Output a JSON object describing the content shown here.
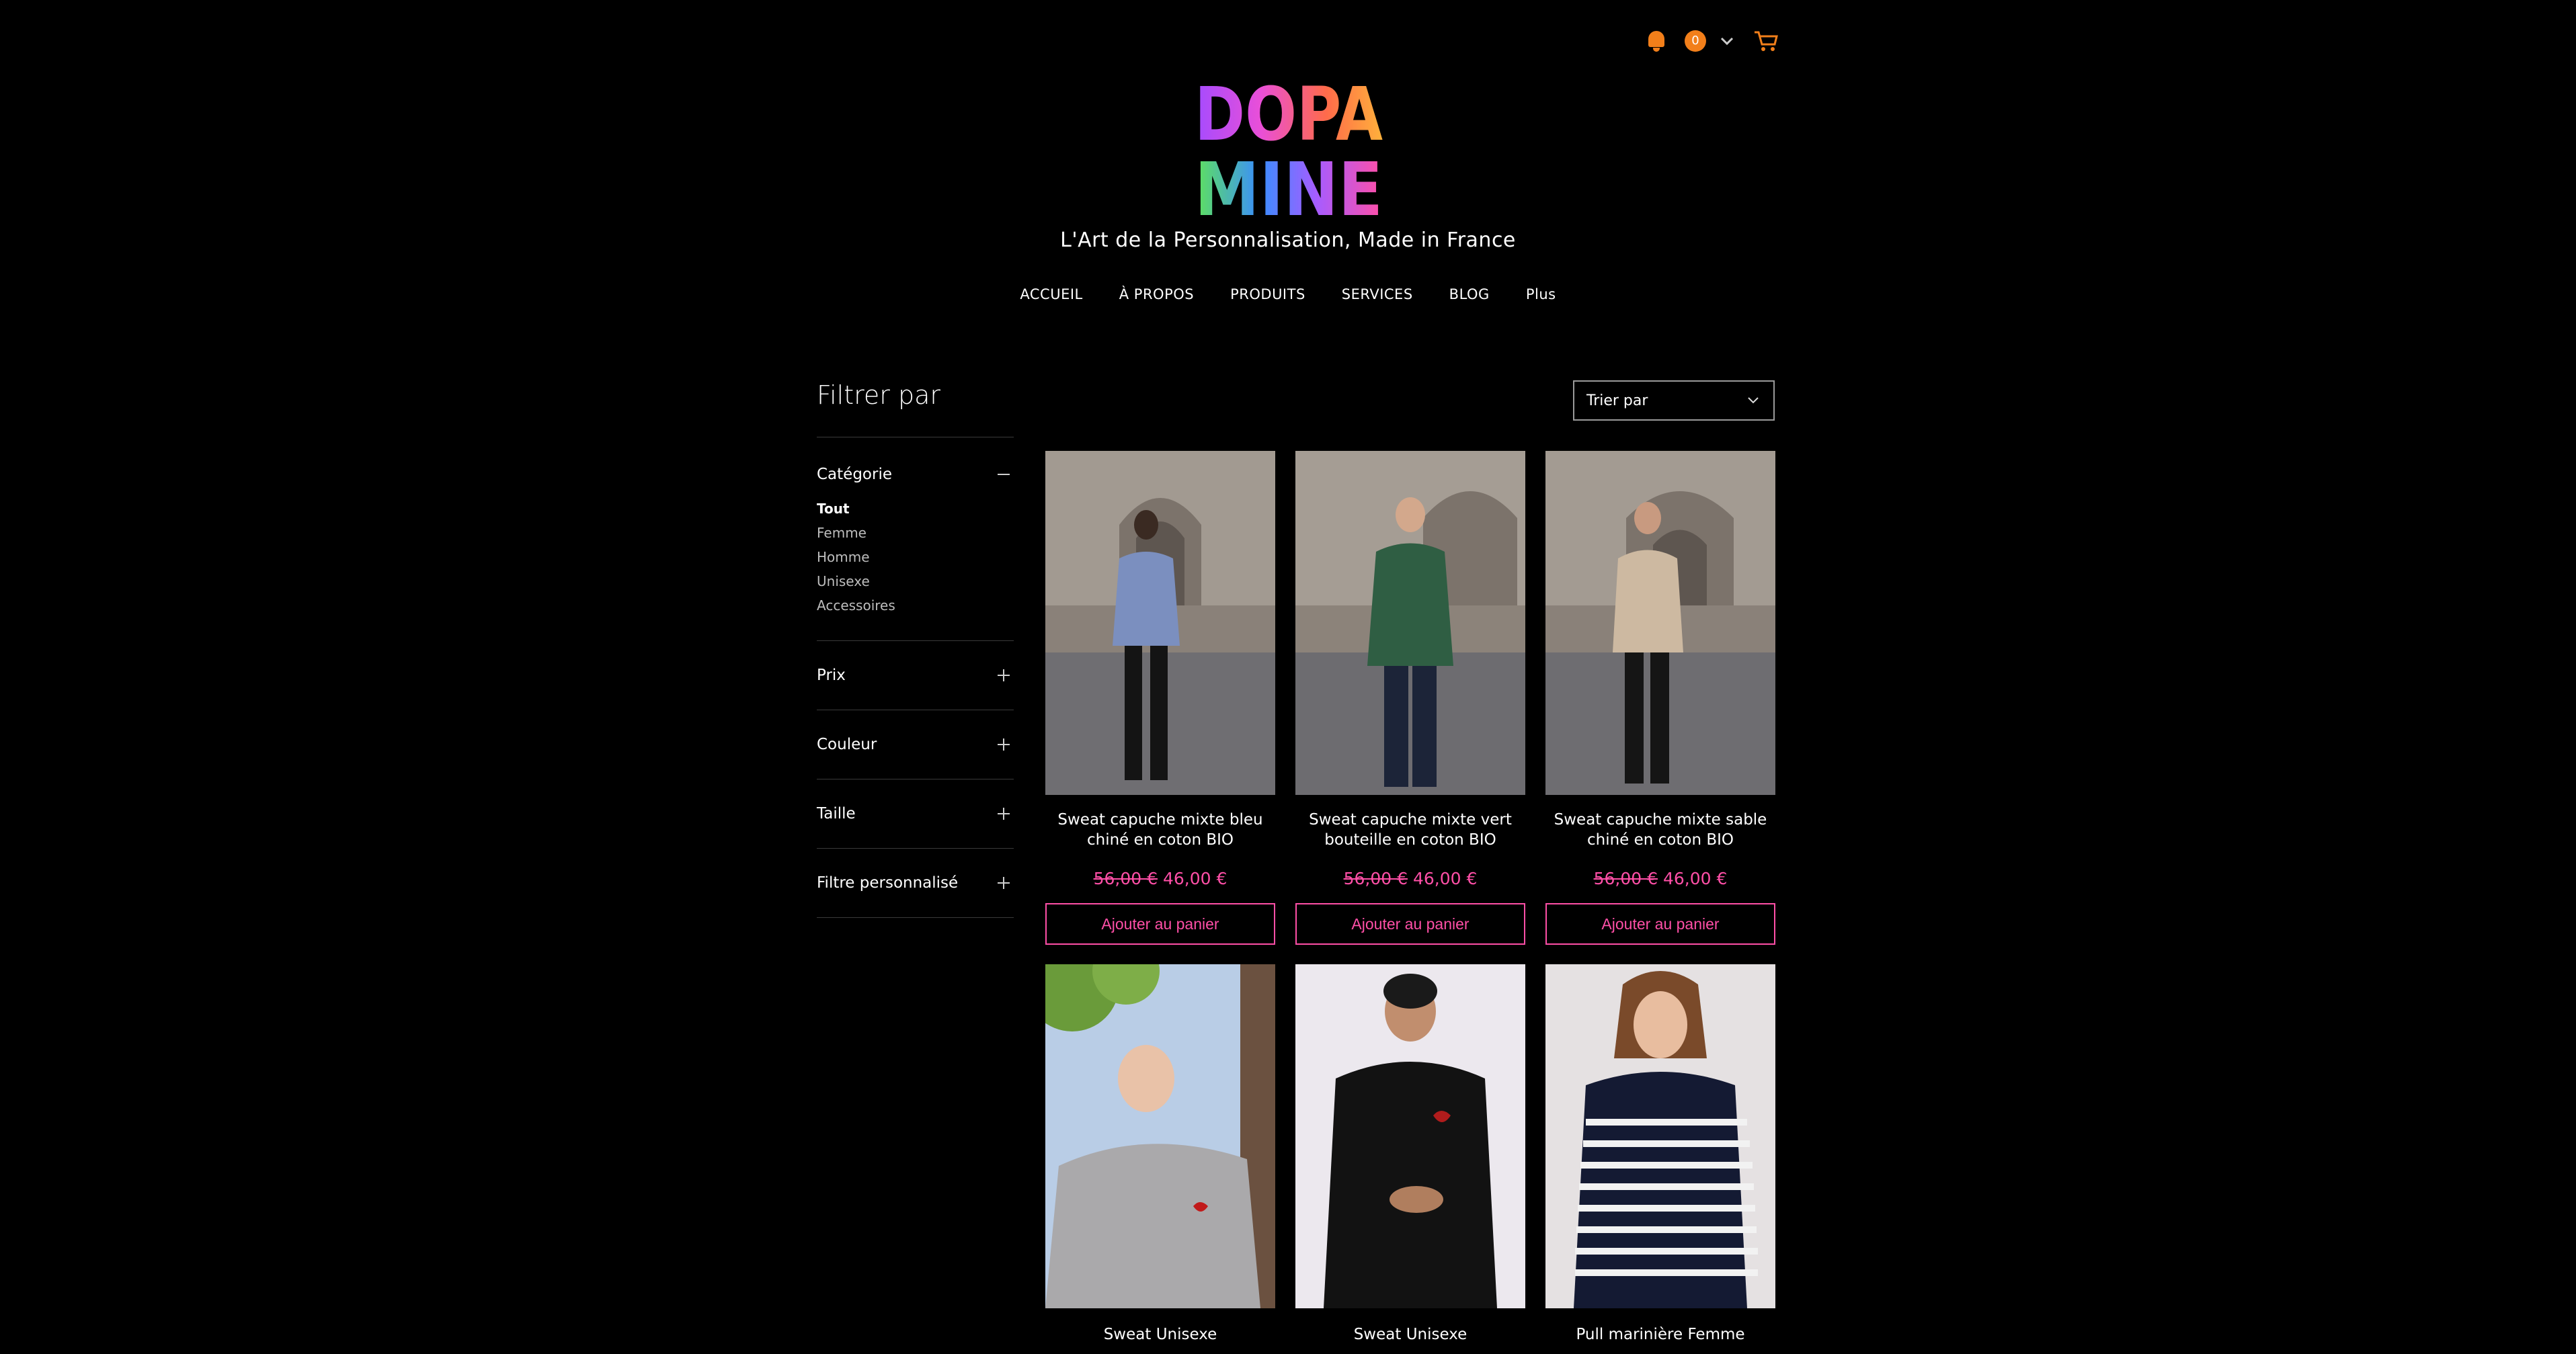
{
  "header": {
    "notification_count": "0",
    "brand_lines": [
      "DOPA",
      "MINE"
    ],
    "tagline": "L'Art de la Personnalisation, Made in France",
    "nav": [
      "ACCUEIL",
      "À PROPOS",
      "PRODUITS",
      "SERVICES",
      "BLOG",
      "Plus"
    ]
  },
  "colors": {
    "accent": "#ff4fa7",
    "notification": "#f27f1a",
    "background": "#000000"
  },
  "sidebar": {
    "title": "Filtrer par",
    "category_label": "Catégorie",
    "categories": [
      "Tout",
      "Femme",
      "Homme",
      "Unisexe",
      "Accessoires"
    ],
    "active_category": "Tout",
    "filters": [
      "Prix",
      "Couleur",
      "Taille",
      "Filtre personnalisé"
    ]
  },
  "sort": {
    "label": "Trier par"
  },
  "products": [
    {
      "name": "Sweat capuche mixte bleu chiné en coton BIO",
      "old_price": "56,00 €",
      "price": "46,00 €",
      "cta": "Ajouter au panier"
    },
    {
      "name": "Sweat capuche mixte vert bouteille en coton BIO",
      "old_price": "56,00 €",
      "price": "46,00 €",
      "cta": "Ajouter au panier"
    },
    {
      "name": "Sweat capuche mixte sable chiné en coton BIO",
      "old_price": "56,00 €",
      "price": "46,00 €",
      "cta": "Ajouter au panier"
    },
    {
      "name": "Sweat Unisexe"
    },
    {
      "name": "Sweat Unisexe"
    },
    {
      "name": "Pull marinière Femme"
    }
  ]
}
